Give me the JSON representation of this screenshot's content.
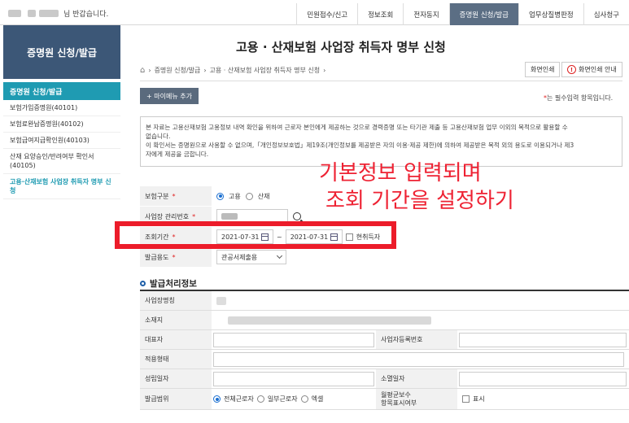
{
  "header": {
    "greeting_suffix": "님 반갑습니다.",
    "nav": [
      "민원접수/신고",
      "정보조회",
      "전자동지",
      "증명원 신청/발급",
      "업무상질병판정",
      "심사청구"
    ],
    "nav_active_index": 3
  },
  "sidebar": {
    "title": "증명원 신청/발급",
    "section": "증명원 신청/발급",
    "items": [
      "보험가입증명원(40101)",
      "보험료완납증명원(40102)",
      "보험급여지급확인원(40103)",
      "산재 요양승인/반려여부 확인서 (40105)",
      "고용·산재보험 사업장 취득자 명부 신청"
    ]
  },
  "page": {
    "title": "고용 · 산재보험 사업장 취득자 명부 신청",
    "breadcrumb": [
      "증명원 신청/발급",
      "고용 · 산재보험 사업장 취득자 명부 신청"
    ],
    "print_label": "화면인쇄",
    "print_guide_label": "화면인쇄 안내",
    "add_menu_label": "+ 마이메뉴 추가",
    "required_note": "는 필수입력 항목입니다.",
    "notice_lines": [
      "본 자료는 고용산재보험 고용정보 내역 확인을 위하여 근로자 본인에게 제공하는 것으로 경력증명 또는 타기관 제출 등 고용산재보험 업무 이외의 목적으로 활용할 수",
      "없습니다.",
      "이 확인서는 증명원으로 사용할 수 없으며,「개인정보보호법」제19조(개인정보를 제공받은 자의 이용·제공 제한)에 의하여 제공받은 목적 외의 용도로 이용되거나 제3",
      "자에게 제공을 금합니다."
    ]
  },
  "form": {
    "insurance_label": "보험구분",
    "insurance_options": [
      "고용",
      "산재"
    ],
    "insurance_selected": "고용",
    "biz_no_label": "사업장 관리번호",
    "period_label": "조회기간",
    "period_from": "2021-07-31",
    "period_sep": "~",
    "period_to": "2021-07-31",
    "current_only_label": "현취득자",
    "purpose_label": "발급용도",
    "purpose_value": "관공서제출용"
  },
  "overlay_text": {
    "line1": "기본정보 입력되며",
    "line2": "조회 기간을 설정하기"
  },
  "issue_section": {
    "title": "발급처리정보",
    "biz_name_label": "사업장명칭",
    "address_label": "소재지",
    "ceo_label": "대표자",
    "reg_no_label": "사업자등록번호",
    "applied_type_label": "적용형태",
    "founded_label": "성립일자",
    "closed_label": "소멸일자",
    "scope_label": "발급범위",
    "scope_options": [
      "전체근로자",
      "일부근로자",
      "엑셀"
    ],
    "scope_selected": "전체근로자",
    "avg_wage_label_1": "월평균보수",
    "avg_wage_label_2": "항목표시여부",
    "show_label": "표시"
  },
  "colors": {
    "sidebar_header": "#3c5777",
    "sidebar_active": "#1f9bb2",
    "highlight_red": "#ec1c2a"
  }
}
